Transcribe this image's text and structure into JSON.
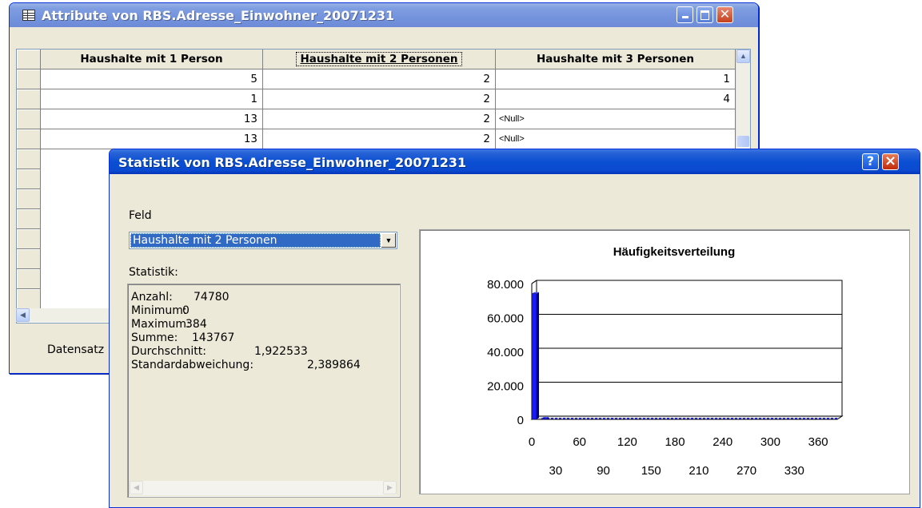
{
  "attribute_window": {
    "title": "Attribute von RBS.Adresse_Einwohner_20071231",
    "columns": [
      "Haushalte mit 1 Person",
      "Haushalte mit 2 Personen",
      "Haushalte mit 3 Personen"
    ],
    "rows": [
      [
        "5",
        "2",
        "1"
      ],
      [
        "1",
        "2",
        "4"
      ],
      [
        "13",
        "2",
        "<Null>"
      ],
      [
        "13",
        "2",
        "<Null>"
      ]
    ],
    "status_label": "Datensatz"
  },
  "stat_window": {
    "title": "Statistik von RBS.Adresse_Einwohner_20071231",
    "help_button": "?",
    "close_button": "×",
    "field_label": "Feld",
    "field_value": "Haushalte mit 2 Personen",
    "stats_label": "Statistik:",
    "stats": [
      {
        "label": "Anzahl:",
        "value": "74780"
      },
      {
        "label": "Minimum:",
        "value": "0"
      },
      {
        "label": "Maximum:",
        "value": "384"
      },
      {
        "label": "Summe:",
        "value": "143767"
      },
      {
        "label": "Durchschnitt:",
        "value": "1,922533"
      },
      {
        "label": "Standardabweichung:",
        "value": "2,389864"
      }
    ]
  },
  "chart_data": {
    "type": "bar",
    "title": "Häufigkeitsverteilung",
    "ylim": [
      0,
      80000
    ],
    "y_ticks": [
      "0",
      "20.000",
      "40.000",
      "60.000",
      "80.000"
    ],
    "x_ticks_top": [
      "0",
      "60",
      "120",
      "180",
      "240",
      "300",
      "360"
    ],
    "x_ticks_bottom": [
      "30",
      "90",
      "150",
      "210",
      "270",
      "330"
    ],
    "xlim": [
      0,
      384
    ],
    "bins": [
      {
        "x": 0,
        "value": 74000
      },
      {
        "x": 12,
        "value": 500
      },
      {
        "x": 24,
        "value": 120
      },
      {
        "x": 36,
        "value": 40
      }
    ],
    "bar_color": "#1a1aff",
    "grid": true
  }
}
